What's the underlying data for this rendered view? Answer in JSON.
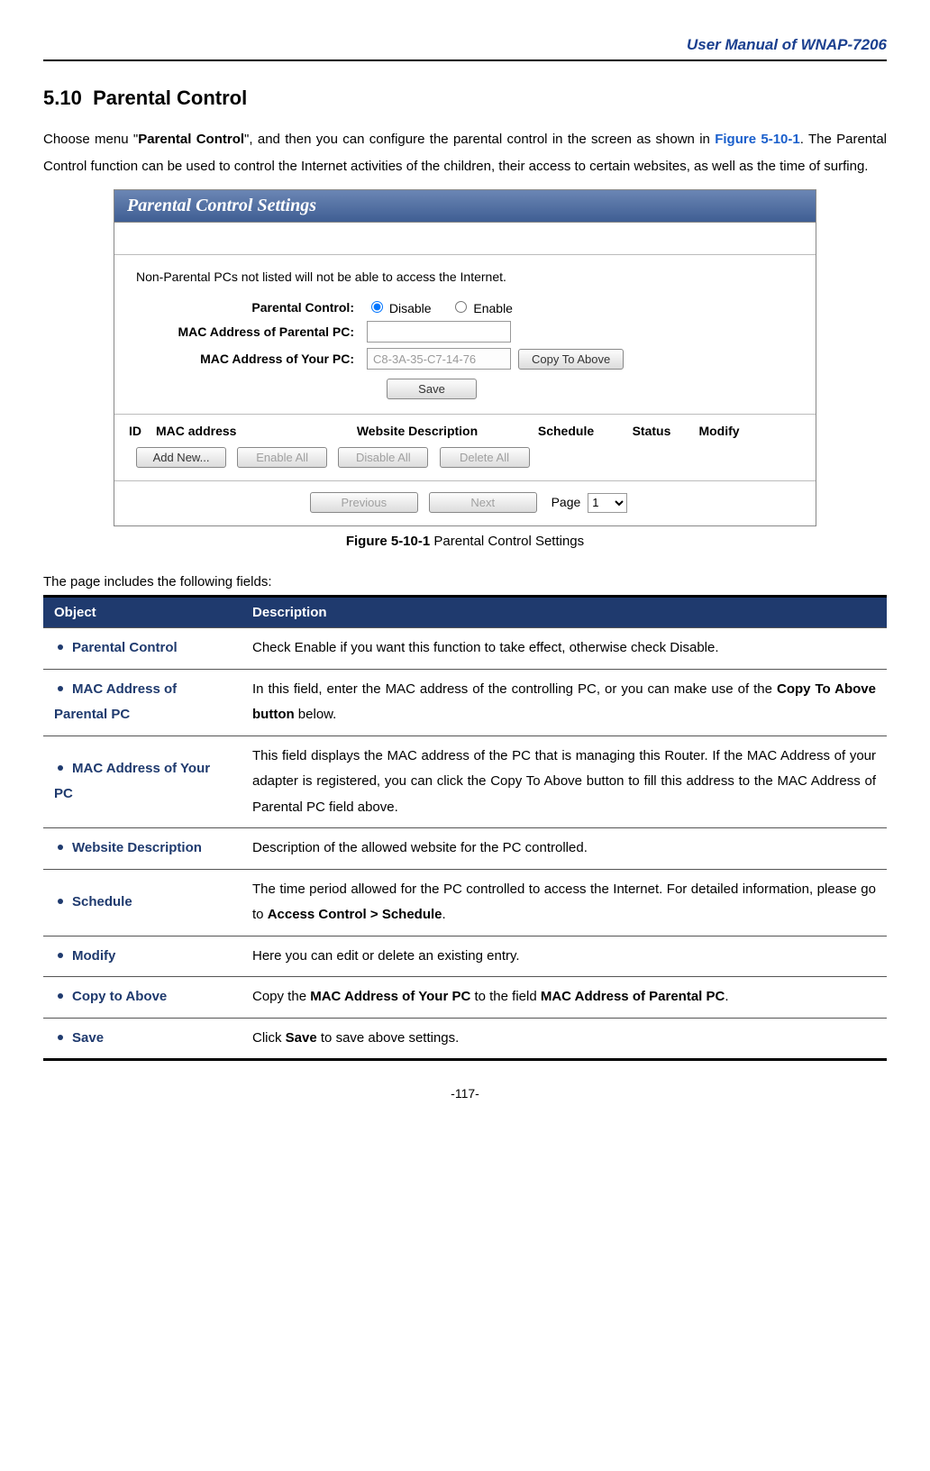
{
  "header": {
    "title": "User Manual of WNAP-7206"
  },
  "section": {
    "number": "5.10",
    "title": "Parental Control",
    "intro_parts": {
      "p1a": "Choose menu \"",
      "p1b": "Parental Control",
      "p1c": "\", and then you can configure the parental control in the screen as shown in ",
      "p1d": "Figure 5-10-1",
      "p1e": ". The Parental Control function can be used to control the Internet activities of the children, their access to certain websites, as well as the time of surfing."
    }
  },
  "screenshot": {
    "title": "Parental Control Settings",
    "note": "Non-Parental PCs not listed will not be able to access the Internet.",
    "labels": {
      "parental_control": "Parental Control:",
      "mac_parental": "MAC Address of Parental PC:",
      "mac_your": "MAC Address of Your PC:"
    },
    "radios": {
      "disable": "Disable",
      "enable": "Enable",
      "selected": "disable"
    },
    "inputs": {
      "mac_parental_value": "",
      "mac_your_value": "C8-3A-35-C7-14-76"
    },
    "buttons": {
      "copy_to_above": "Copy To Above",
      "save": "Save",
      "add_new": "Add New...",
      "enable_all": "Enable All",
      "disable_all": "Disable All",
      "delete_all": "Delete All",
      "previous": "Previous",
      "next": "Next"
    },
    "table_headers": {
      "id": "ID",
      "mac": "MAC address",
      "website": "Website Description",
      "schedule": "Schedule",
      "status": "Status",
      "modify": "Modify"
    },
    "pager": {
      "page_label": "Page",
      "page_value": "1"
    }
  },
  "figure_caption": {
    "bold": "Figure 5-10-1",
    "rest": " Parental Control Settings"
  },
  "fields_intro": "The page includes the following fields:",
  "desc_table": {
    "headers": {
      "object": "Object",
      "description": "Description"
    },
    "rows": [
      {
        "object": "Parental Control",
        "desc_parts": [
          "Check Enable if you want this function to take effect, otherwise check Disable."
        ]
      },
      {
        "object": "MAC Address of Parental PC",
        "desc_parts": [
          "In this field, enter the MAC address of the controlling PC, or you can make use of the ",
          "**Copy To Above button**",
          " below."
        ]
      },
      {
        "object": "MAC Address of Your PC",
        "desc_parts": [
          "This field displays the MAC address of the PC that is managing this Router. If the MAC Address of your adapter is registered, you can click the Copy To Above button to fill this address to the MAC Address of Parental PC field above."
        ]
      },
      {
        "object": "Website Description",
        "desc_parts": [
          "Description of the allowed website for the PC controlled."
        ]
      },
      {
        "object": "Schedule",
        "desc_parts": [
          "The time period allowed for the PC controlled to access the Internet. For detailed information, please go to ",
          "**Access Control > Schedule**",
          "."
        ]
      },
      {
        "object": "Modify",
        "desc_parts": [
          "Here you can edit or delete an existing entry."
        ]
      },
      {
        "object": "Copy to Above",
        "desc_parts": [
          "Copy the ",
          "**MAC Address of Your PC**",
          " to the field ",
          "**MAC Address of Parental PC**",
          "."
        ]
      },
      {
        "object": "Save",
        "desc_parts": [
          "Click ",
          "**Save**",
          " to save above settings."
        ]
      }
    ]
  },
  "page_number": "-117-"
}
